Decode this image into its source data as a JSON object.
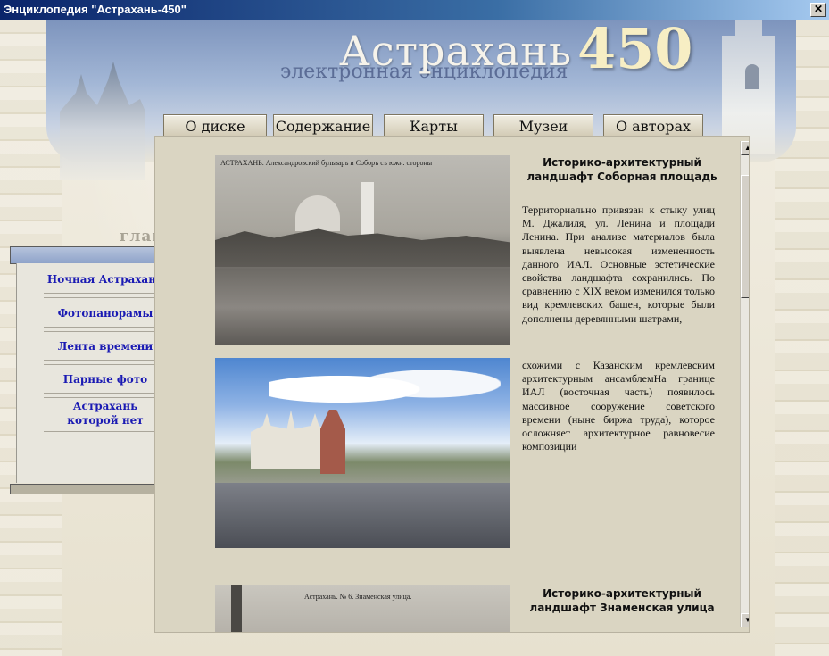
{
  "window": {
    "title": "Энциклопедия \"Астрахань-450\"",
    "close_label": "✕"
  },
  "header": {
    "title": "Астрахань",
    "number": "450",
    "subtitle": "электронная энциклопедия"
  },
  "nav": [
    {
      "label": "О диске"
    },
    {
      "label": "Содержание"
    },
    {
      "label": "Карты"
    },
    {
      "label": "Музеи"
    },
    {
      "label": "О авторах"
    }
  ],
  "sidebar": {
    "heading": "главная",
    "items": [
      {
        "label": "Ночная Астрахань"
      },
      {
        "label": "Фотопанорамы"
      },
      {
        "label": "Лента времени"
      },
      {
        "label": "Парные фото"
      },
      {
        "label": "Астрахань которой нет"
      }
    ]
  },
  "content": {
    "photo1_caption": "АСТРАХАНЬ. Александровский бульваръ и Соборъ съ южн. стороны",
    "photo3_caption": "Астрахань. № 6. Знаменская улица.",
    "section1_title": "Историко-архитектурный ландшафт Соборная площадь",
    "section1_para1": "Территориально привязан к стыку улиц М. Джалиля, ул. Ленина и площади Ленина. При анализе материалов была выявлена невысокая измененность данного ИАЛ. Основные эстетические свойства ландшафта сохранились. По сравнению с XIX веком изменился только вид кремлевских башен, которые были дополнены деревянными шатрами,",
    "section1_para2": "схожими с Казанским кремлевским архитектурным ансамблемНа границе ИАЛ (восточная часть) появилось массивное сооружение советского времени (ныне биржа труда), которое осложняет архитектурное равновесие композиции",
    "section2_title": "Историко-архитектурный ландшафт Знаменская улица"
  },
  "scrollbar": {
    "up": "▲",
    "down": "▼"
  }
}
